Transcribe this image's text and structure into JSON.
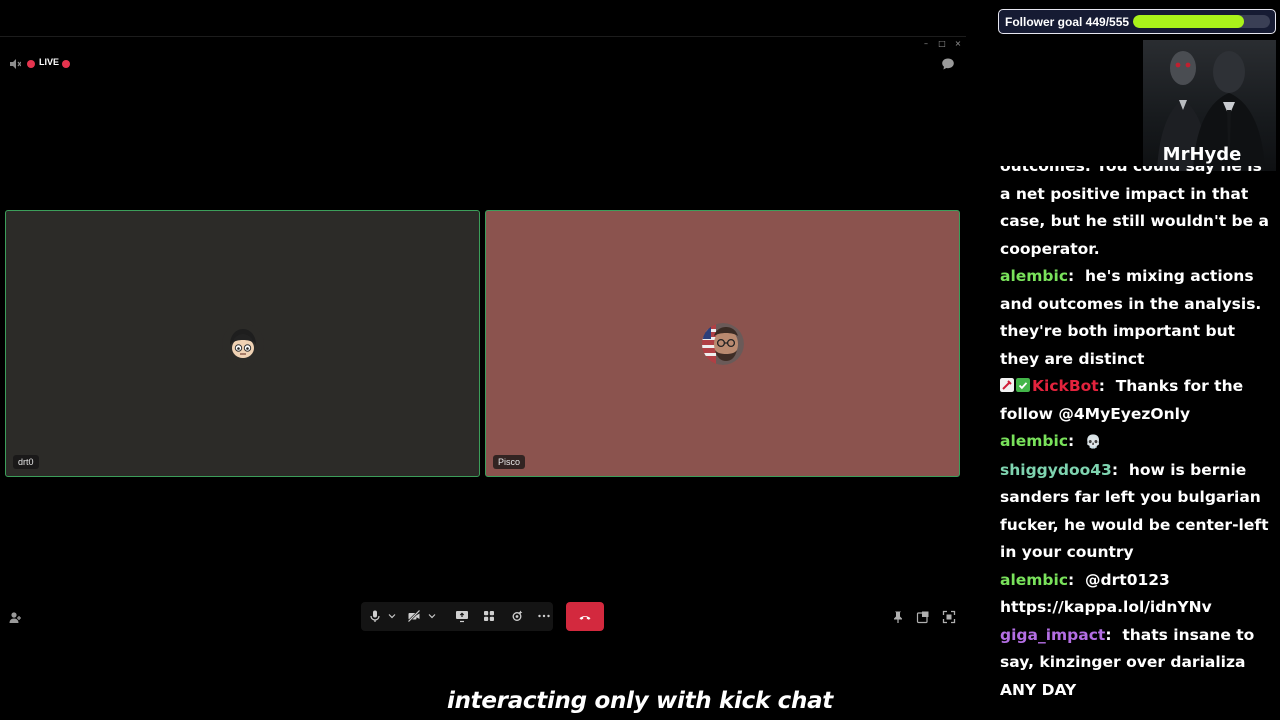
{
  "call": {
    "live_label": "LIVE",
    "participants": [
      {
        "name": "drt0",
        "tile_color": "#2c2b28"
      },
      {
        "name": "Pisco",
        "tile_color": "#8b534e"
      }
    ]
  },
  "caption": "interacting only with kick chat",
  "follower_goal": {
    "label": "Follower goal 449/555",
    "current": 449,
    "target": 555,
    "bar_color": "#aaf31a"
  },
  "webcam": {
    "name": "MrHyde"
  },
  "chat": {
    "messages": [
      {
        "user": "",
        "text": "outcomes. You could say he is a net positive impact in that case, but he still wouldn't be a cooperator."
      },
      {
        "user": "alembic",
        "user_color": "#79e25b",
        "text": "he's mixing actions and outcomes in the analysis. they're both important but they are distinct"
      },
      {
        "user": "KickBot",
        "user_color": "#e3233d",
        "text": "Thanks for the follow @4MyEyezOnly"
      },
      {
        "user": "alembic",
        "user_color": "#79e25b",
        "text": "💀"
      },
      {
        "user": "shiggydoo43",
        "user_color": "#7fd4b0",
        "text": "how is bernie sanders far left you bulgarian fucker, he would be center-left in your country"
      },
      {
        "user": "alembic",
        "user_color": "#79e25b",
        "text": "@drt0123 https://kappa.lol/idnYNv"
      },
      {
        "user": "giga_impact",
        "user_color": "#b36ee3",
        "text": "thats insane to say, kinzinger over darializa ANY DAY"
      }
    ]
  }
}
